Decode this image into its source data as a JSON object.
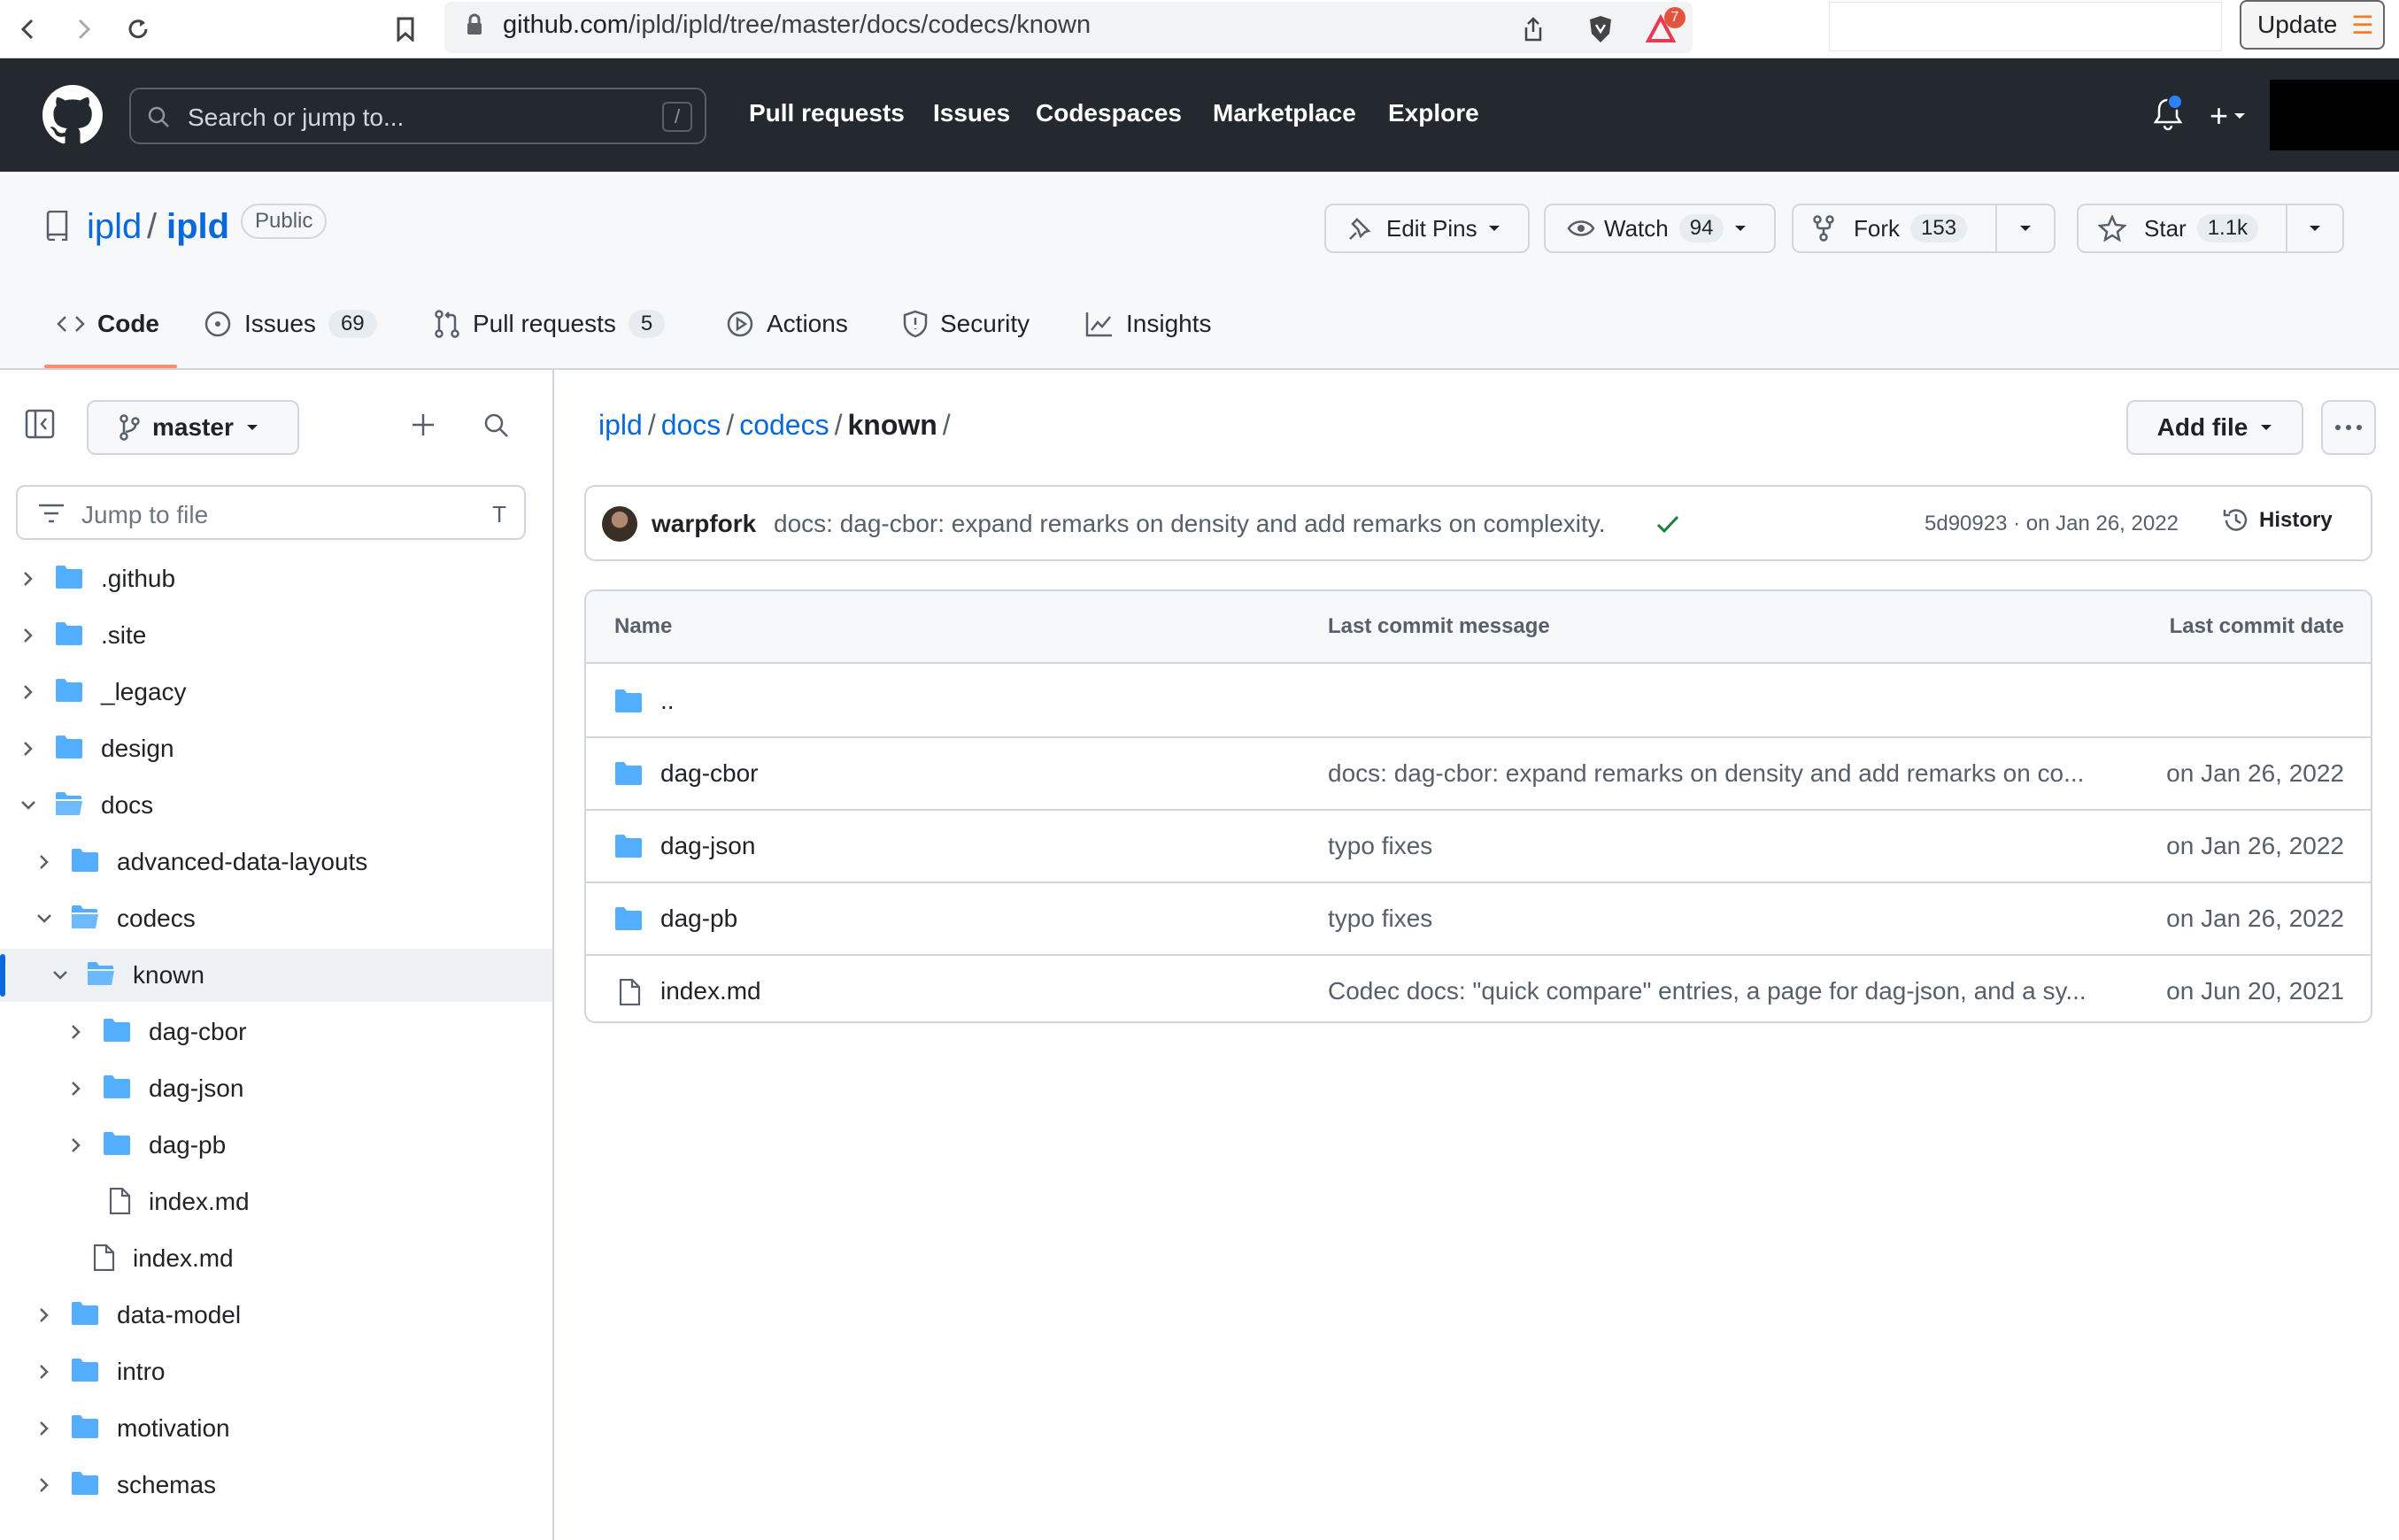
{
  "browser": {
    "url_host": "github.com",
    "url_path": "/ipld/ipld/tree/master/docs/codecs/known",
    "update_label": "Update",
    "shield_badge": "7"
  },
  "header": {
    "search_placeholder": "Search or jump to...",
    "search_key": "/",
    "nav": [
      "Pull requests",
      "Issues",
      "Codespaces",
      "Marketplace",
      "Explore"
    ],
    "plus_label": "+"
  },
  "repo": {
    "owner": "ipld",
    "separator": "/",
    "name": "ipld",
    "visibility": "Public",
    "edit_pins_label": "Edit Pins",
    "watch_label": "Watch",
    "watch_count": "94",
    "fork_label": "Fork",
    "fork_count": "153",
    "star_label": "Star",
    "star_count": "1.1k",
    "tabs": [
      {
        "label": "Code",
        "count": ""
      },
      {
        "label": "Issues",
        "count": "69"
      },
      {
        "label": "Pull requests",
        "count": "5"
      },
      {
        "label": "Actions",
        "count": ""
      },
      {
        "label": "Security",
        "count": ""
      },
      {
        "label": "Insights",
        "count": ""
      }
    ]
  },
  "sidebar": {
    "branch": "master",
    "jump_placeholder": "Jump to file",
    "jump_key": "T",
    "tree": [
      {
        "label": ".github",
        "type": "folder",
        "expanded": false,
        "depth": 0
      },
      {
        "label": ".site",
        "type": "folder",
        "expanded": false,
        "depth": 0
      },
      {
        "label": "_legacy",
        "type": "folder",
        "expanded": false,
        "depth": 0
      },
      {
        "label": "design",
        "type": "folder",
        "expanded": false,
        "depth": 0
      },
      {
        "label": "docs",
        "type": "folder",
        "expanded": true,
        "depth": 0
      },
      {
        "label": "advanced-data-layouts",
        "type": "folder",
        "expanded": false,
        "depth": 1
      },
      {
        "label": "codecs",
        "type": "folder",
        "expanded": true,
        "depth": 1
      },
      {
        "label": "known",
        "type": "folder",
        "expanded": true,
        "depth": 2,
        "selected": true
      },
      {
        "label": "dag-cbor",
        "type": "folder",
        "expanded": false,
        "depth": 3
      },
      {
        "label": "dag-json",
        "type": "folder",
        "expanded": false,
        "depth": 3
      },
      {
        "label": "dag-pb",
        "type": "folder",
        "expanded": false,
        "depth": 3
      },
      {
        "label": "index.md",
        "type": "file",
        "depth": 3
      },
      {
        "label": "index.md",
        "type": "file",
        "depth": 2
      },
      {
        "label": "data-model",
        "type": "folder",
        "expanded": false,
        "depth": 1
      },
      {
        "label": "intro",
        "type": "folder",
        "expanded": false,
        "depth": 1
      },
      {
        "label": "motivation",
        "type": "folder",
        "expanded": false,
        "depth": 1
      },
      {
        "label": "schemas",
        "type": "folder",
        "expanded": false,
        "depth": 1
      }
    ]
  },
  "main": {
    "breadcrumb": [
      "ipld",
      "docs",
      "codecs"
    ],
    "breadcrumb_current": "known",
    "breadcrumb_sep": "/",
    "add_file_label": "Add file",
    "commit": {
      "author": "warpfork",
      "message": "docs: dag-cbor: expand remarks on density and add remarks on complexity.",
      "sha_date": "5d90923 · on Jan 26, 2022",
      "history_label": "History"
    },
    "table": {
      "headers": [
        "Name",
        "Last commit message",
        "Last commit date"
      ],
      "rows": [
        {
          "name": "..",
          "type": "folder",
          "message": "",
          "date": ""
        },
        {
          "name": "dag-cbor",
          "type": "folder",
          "message": "docs: dag-cbor: expand remarks on density and add remarks on co...",
          "date": "on Jan 26, 2022"
        },
        {
          "name": "dag-json",
          "type": "folder",
          "message": "typo fixes",
          "date": "on Jan 26, 2022"
        },
        {
          "name": "dag-pb",
          "type": "folder",
          "message": "typo fixes",
          "date": "on Jan 26, 2022"
        },
        {
          "name": "index.md",
          "type": "file",
          "message": "Codec docs: \"quick compare\" entries, a page for dag-json, and a sy...",
          "date": "on Jun 20, 2021"
        }
      ]
    }
  },
  "colors": {
    "accent": "#0969da",
    "folder": "#54aeff",
    "header_bg": "#24292f",
    "tab_underline": "#fd8c73",
    "success": "#1a7f37"
  }
}
